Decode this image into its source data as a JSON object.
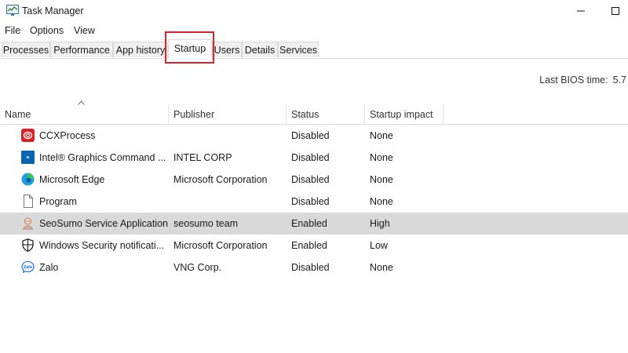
{
  "window": {
    "title": "Task Manager"
  },
  "menu": [
    "File",
    "Options",
    "View"
  ],
  "tabs": [
    "Processes",
    "Performance",
    "App history",
    "Startup",
    "Users",
    "Details",
    "Services"
  ],
  "active_tab": "Startup",
  "bios": {
    "label": "Last BIOS time:",
    "value": "5.7"
  },
  "columns": {
    "name": "Name",
    "publisher": "Publisher",
    "status": "Status",
    "impact": "Startup impact"
  },
  "rows": [
    {
      "name": "CCXProcess",
      "publisher": "",
      "status": "Disabled",
      "impact": "None",
      "icon": "adobe-ccx-icon"
    },
    {
      "name": "Intel® Graphics Command ...",
      "publisher": "INTEL CORP",
      "status": "Disabled",
      "impact": "None",
      "icon": "intel-graphics-icon"
    },
    {
      "name": "Microsoft Edge",
      "publisher": "Microsoft Corporation",
      "status": "Disabled",
      "impact": "None",
      "icon": "edge-icon"
    },
    {
      "name": "Program",
      "publisher": "",
      "status": "Disabled",
      "impact": "None",
      "icon": "blank-file-icon"
    },
    {
      "name": "SeoSumo Service Application",
      "publisher": "seosumo team",
      "status": "Enabled",
      "impact": "High",
      "icon": "seosumo-icon"
    },
    {
      "name": "Windows Security notificati...",
      "publisher": "Microsoft Corporation",
      "status": "Enabled",
      "impact": "Low",
      "icon": "shield-icon"
    },
    {
      "name": "Zalo",
      "publisher": "VNG Corp.",
      "status": "Disabled",
      "impact": "None",
      "icon": "zalo-icon"
    }
  ],
  "colors": {
    "highlight": "#d6232d",
    "selected_row": "#d9d9d9"
  }
}
